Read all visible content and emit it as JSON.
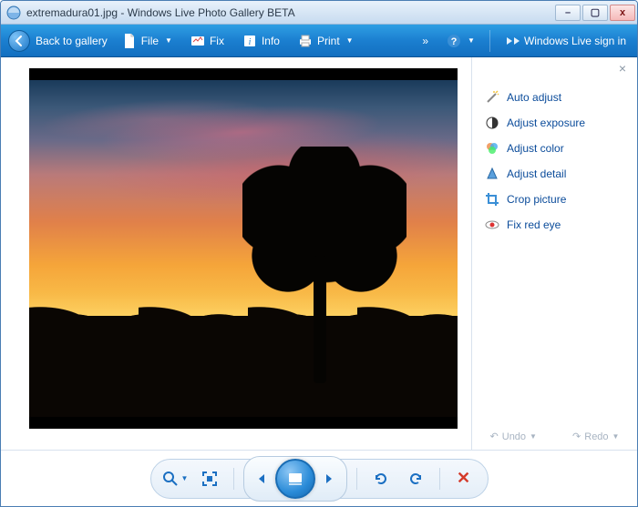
{
  "window": {
    "filename": "extremadura01.jpg",
    "app_name": "Windows Live Photo Gallery BETA",
    "title_separator": " - "
  },
  "toolbar": {
    "back_label": "Back to gallery",
    "file_label": "File",
    "fix_label": "Fix",
    "info_label": "Info",
    "print_label": "Print",
    "signin_label": "Windows Live sign in"
  },
  "fixpanel": {
    "items": [
      {
        "label": "Auto adjust",
        "icon": "wand-icon"
      },
      {
        "label": "Adjust exposure",
        "icon": "contrast-icon"
      },
      {
        "label": "Adjust color",
        "icon": "color-icon"
      },
      {
        "label": "Adjust detail",
        "icon": "sharpen-icon"
      },
      {
        "label": "Crop picture",
        "icon": "crop-icon"
      },
      {
        "label": "Fix red eye",
        "icon": "redeye-icon"
      }
    ],
    "undo_label": "Undo",
    "redo_label": "Redo"
  },
  "colors": {
    "toolbar_blue": "#1b7fd0",
    "link_blue": "#0a4b9a"
  }
}
